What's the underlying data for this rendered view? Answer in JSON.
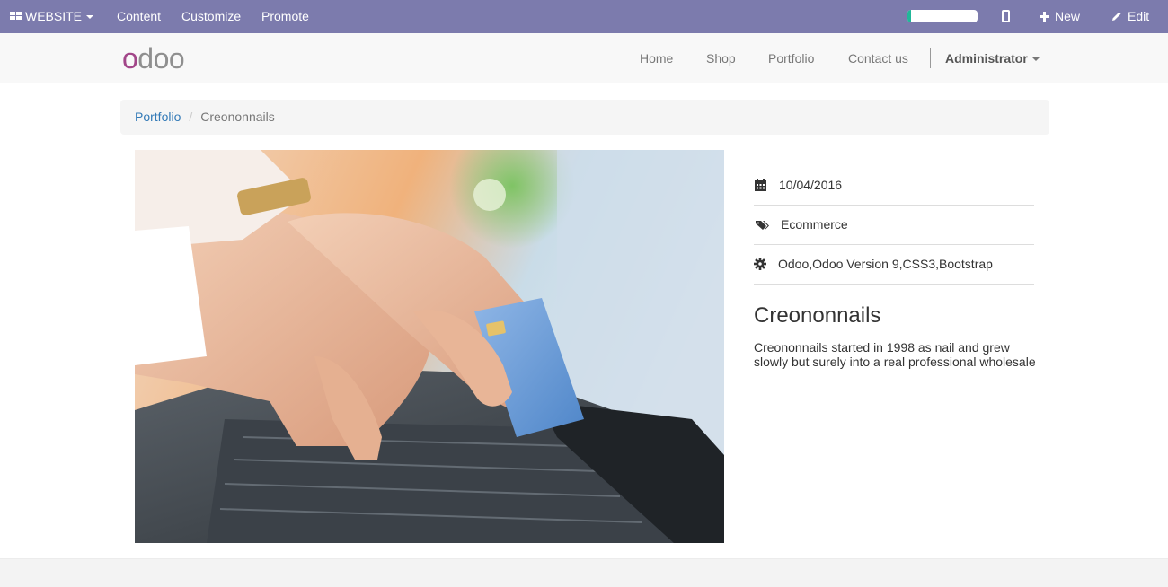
{
  "admin_bar": {
    "website_label": "WEBSITE",
    "menu": [
      "Content",
      "Customize",
      "Promote"
    ],
    "progress_fraction": 0.05,
    "new_label": "New",
    "edit_label": "Edit",
    "accent_color": "#7c7bad"
  },
  "header": {
    "logo_first": "o",
    "logo_rest": "doo",
    "nav": [
      "Home",
      "Shop",
      "Portfolio",
      "Contact us"
    ],
    "user": "Administrator"
  },
  "breadcrumb": {
    "parent": "Portfolio",
    "separator": "/",
    "current": "Creononnails"
  },
  "project": {
    "date": "10/04/2016",
    "category": "Ecommerce",
    "technologies": "Odoo,Odoo Version 9,CSS3,Bootstrap",
    "title": "Creononnails",
    "description": "Creononnails started in 1998 as nail and grew slowly but surely into a real professional wholesale"
  },
  "icons": {
    "date": "calendar-icon",
    "category": "tags-icon",
    "technologies": "gear-icon"
  }
}
